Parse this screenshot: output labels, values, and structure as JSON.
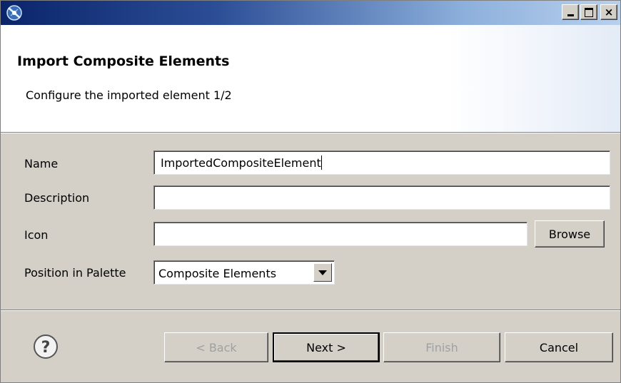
{
  "window": {
    "title": "",
    "controls": {
      "minimize_icon": "minimize-icon",
      "maximize_icon": "maximize-icon",
      "close_icon": "close-icon",
      "close_glyph": "×"
    }
  },
  "banner": {
    "title": "Import Composite Elements",
    "subtitle": "Configure the imported element 1/2"
  },
  "form": {
    "name": {
      "label": "Name",
      "value": "ImportedCompositeElement"
    },
    "description": {
      "label": "Description",
      "value": ""
    },
    "icon": {
      "label": "Icon",
      "value": "",
      "browse_label": "Browse"
    },
    "position": {
      "label": "Position in Palette",
      "selected": "Composite Elements"
    }
  },
  "footer": {
    "help_icon": "help-icon",
    "back_label": "< Back",
    "next_label": "Next >",
    "finish_label": "Finish",
    "cancel_label": "Cancel"
  },
  "colors": {
    "title_bar_start": "#0a246a",
    "title_bar_end": "#b9d0ec",
    "dialog_face": "#d4d0c8",
    "banner_background": "#ffffff",
    "disabled_text": "#a0a0a0"
  }
}
